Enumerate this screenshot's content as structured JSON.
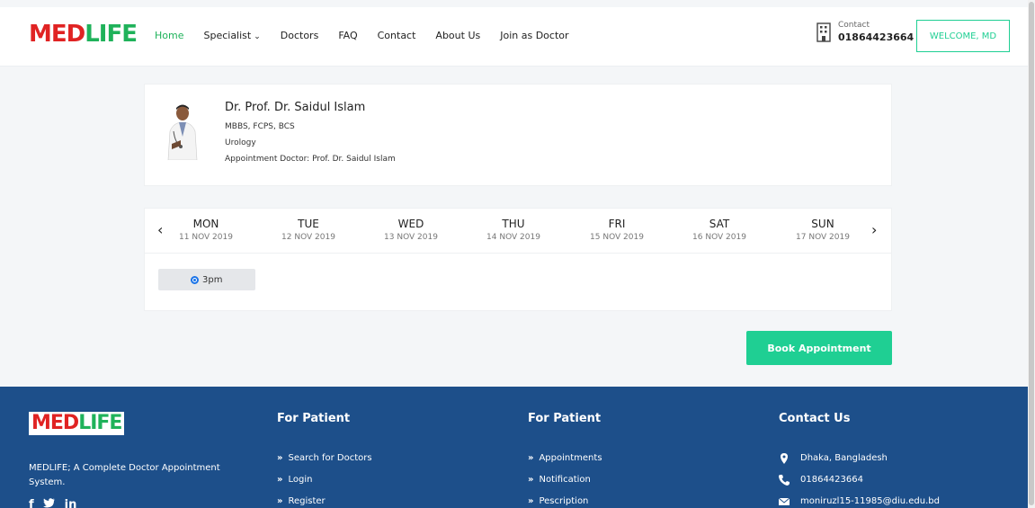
{
  "header": {
    "logo": {
      "part1": "MED",
      "part2": "LIFE"
    },
    "nav": [
      {
        "label": "Home",
        "active": true
      },
      {
        "label": "Specialist",
        "dropdown": true
      },
      {
        "label": "Doctors"
      },
      {
        "label": "FAQ"
      },
      {
        "label": "Contact"
      },
      {
        "label": "About Us"
      },
      {
        "label": "Join as Doctor"
      }
    ],
    "contact_label": "Contact",
    "contact_phone": "01864423664",
    "welcome_button": "WELCOME, MD"
  },
  "doctor": {
    "name": "Dr. Prof. Dr. Saidul Islam",
    "degrees": "MBBS, FCPS, BCS",
    "department": "Urology",
    "appointment_line": "Appointment Doctor: Prof. Dr. Saidul Islam"
  },
  "schedule": {
    "prev_icon": "chevron-left-icon",
    "next_icon": "chevron-right-icon",
    "days": [
      {
        "name": "MON",
        "date": "11 NOV 2019"
      },
      {
        "name": "TUE",
        "date": "12 NOV 2019"
      },
      {
        "name": "WED",
        "date": "13 NOV 2019"
      },
      {
        "name": "THU",
        "date": "14 NOV 2019"
      },
      {
        "name": "FRI",
        "date": "15 NOV 2019"
      },
      {
        "name": "SAT",
        "date": "16 NOV 2019"
      },
      {
        "name": "SUN",
        "date": "17 NOV 2019"
      }
    ],
    "slot": {
      "label": "3pm",
      "selected": true
    }
  },
  "book_button": "Book Appointment",
  "footer": {
    "logo": {
      "part1": "MED",
      "part2": "LIFE"
    },
    "tagline": "MEDLIFE; A Complete Doctor Appointment System.",
    "social": [
      "f",
      "in"
    ],
    "col1": {
      "title": "For Patient",
      "links": [
        "Search for Doctors",
        "Login",
        "Register"
      ]
    },
    "col2": {
      "title": "For Patient",
      "links": [
        "Appointments",
        "Notification",
        "Pescription"
      ]
    },
    "contact": {
      "title": "Contact Us",
      "address": "Dhaka, Bangladesh",
      "phone": "01864423664",
      "email": "moniruzl15-11985@diu.edu.bd"
    }
  },
  "colors": {
    "accent": "#1fcf93",
    "brand_red": "#e02323",
    "brand_green": "#1fb25a",
    "footer_bg": "#1d4f8a"
  }
}
